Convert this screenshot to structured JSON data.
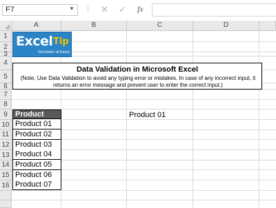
{
  "formula_bar": {
    "name_box": "F7",
    "dots": "⋮",
    "cancel_icon": "✕",
    "enter_icon": "✓",
    "fx_label": "fx",
    "content": ""
  },
  "columns": [
    "A",
    "B",
    "C",
    "D"
  ],
  "rows": [
    "1",
    "2",
    "3",
    "4",
    "5",
    "6",
    "7",
    "8",
    "9",
    "10",
    "11",
    "12",
    "13",
    "14",
    "15",
    "16"
  ],
  "logo": {
    "word1": "Excel",
    "word2": "Tip",
    "tagline": "Get better at Excel"
  },
  "title": "Data Validation in Microsoft Excel",
  "note": "(Note, Use Data Validation to avoid any typing error or mistakes. In case of any incorrect input, it returns an error message and prevent user to enter the correct input.)",
  "table": {
    "header": "Product Name",
    "items": [
      "Product 01",
      "Product 02",
      "Product 03",
      "Product 04",
      "Product 05",
      "Product 06",
      "Product 07"
    ]
  },
  "cell_C8": "Product 01"
}
